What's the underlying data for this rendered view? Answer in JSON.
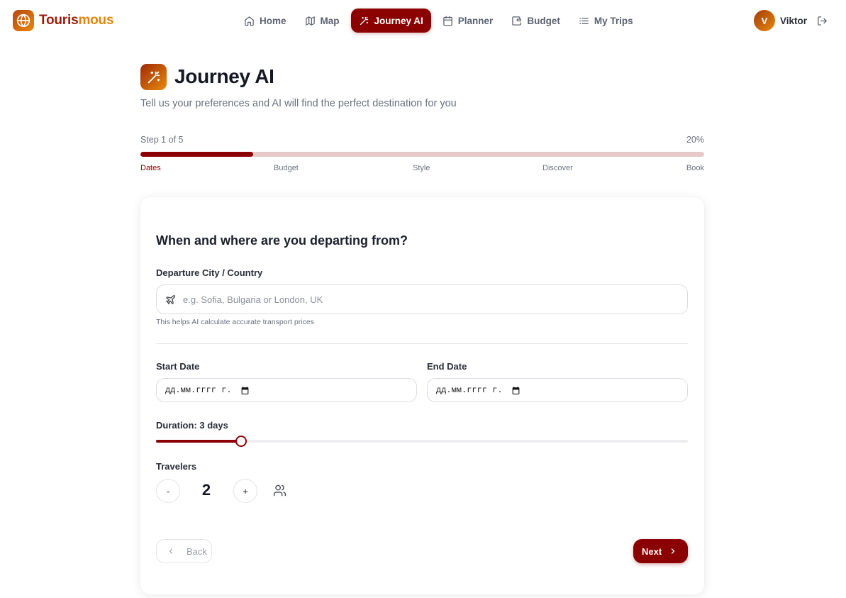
{
  "brand": {
    "name_part1": "Touris",
    "name_part2": "mous",
    "logo_icon": "globe-icon"
  },
  "nav": {
    "items": [
      {
        "label": "Home",
        "icon": "home-icon",
        "active": false
      },
      {
        "label": "Map",
        "icon": "map-icon",
        "active": false
      },
      {
        "label": "Journey AI",
        "icon": "magic-wand-icon",
        "active": true
      },
      {
        "label": "Planner",
        "icon": "calendar-icon",
        "active": false
      },
      {
        "label": "Budget",
        "icon": "wallet-icon",
        "active": false
      },
      {
        "label": "My Trips",
        "icon": "list-icon",
        "active": false
      }
    ]
  },
  "user": {
    "initial": "V",
    "name": "Viktor",
    "logout_icon": "logout-icon"
  },
  "header": {
    "title": "Journey AI",
    "subtitle": "Tell us your preferences and AI will find the perfect destination for you",
    "icon": "magic-wand-icon"
  },
  "progress": {
    "step_text": "Step 1 of 5",
    "percent_text": "20%",
    "percent": 20,
    "steps": [
      "Dates",
      "Budget",
      "Style",
      "Discover",
      "Book"
    ],
    "current_step": 0
  },
  "form": {
    "question": "When and where are you departing from?",
    "departure_label": "Departure City / Country",
    "departure_placeholder": "e.g. Sofia, Bulgaria or London, UK",
    "departure_value": "",
    "departure_hint": "This helps AI calculate accurate transport prices",
    "start_label": "Start Date",
    "start_value": "дд.мм.гггг г.",
    "end_label": "End Date",
    "end_value": "дд.мм.гггг г.",
    "duration_label": "Duration: 3 days",
    "duration_fraction": 0.16,
    "travelers_label": "Travelers",
    "travelers_count": "2",
    "decrement_label": "-",
    "increment_label": "+"
  },
  "actions": {
    "back_label": "Back",
    "next_label": "Next"
  },
  "colors": {
    "accent": "#8b0000",
    "brand_orange": "#e0860d",
    "track": "#e8c9c9"
  }
}
